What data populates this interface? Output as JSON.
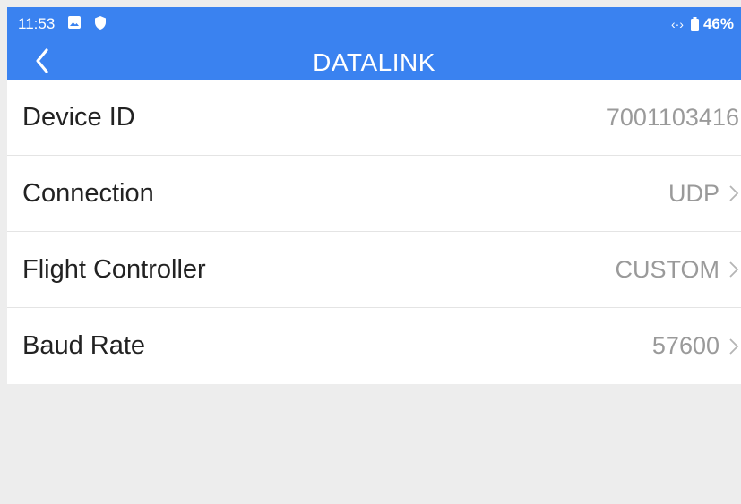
{
  "status_bar": {
    "time": "11:53",
    "battery": "46%",
    "icons": [
      "gallery-icon",
      "shield-icon",
      "data-transfer-icon",
      "battery-icon"
    ]
  },
  "header": {
    "title": "DATALINK",
    "back_icon": "chevron-left-icon",
    "color": "#3a82f0"
  },
  "settings": [
    {
      "label": "Device ID",
      "value": "7001103416",
      "has_chevron": false
    },
    {
      "label": "Connection",
      "value": "UDP",
      "has_chevron": true
    },
    {
      "label": "Flight Controller",
      "value": "CUSTOM",
      "has_chevron": true
    },
    {
      "label": "Baud Rate",
      "value": "57600",
      "has_chevron": true
    }
  ]
}
